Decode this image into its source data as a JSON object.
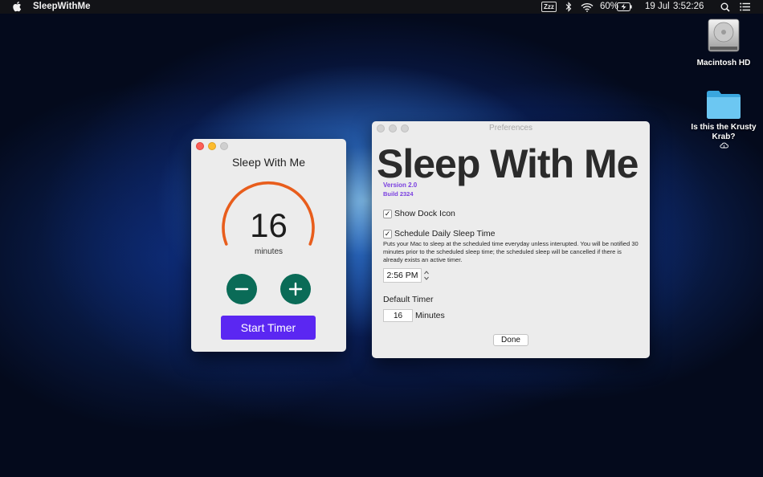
{
  "menubar": {
    "app_name": "SleepWithMe",
    "zzz_label": "Zzz",
    "battery_percent": "60%",
    "date": "19 Jul",
    "time": "3:52:26"
  },
  "desktop": {
    "items": [
      {
        "label": "Macintosh HD"
      },
      {
        "label": "Is this the Krusty Krab?"
      }
    ]
  },
  "timer_window": {
    "title": "Sleep With Me",
    "dial_value": "16",
    "dial_unit": "minutes",
    "dial_fill_fraction": 0.72,
    "start_button": "Start Timer",
    "accent_color": "#e85d1c",
    "button_color": "#0a6b57",
    "start_color": "#5b27f2"
  },
  "preferences": {
    "window_title": "Preferences",
    "app_title": "Sleep With Me",
    "version": "Version 2.0",
    "build": "Build 2324",
    "show_dock_icon": {
      "label": "Show Dock Icon",
      "checked": true
    },
    "schedule_sleep": {
      "label": "Schedule Daily Sleep Time",
      "checked": true
    },
    "schedule_description": "Puts your Mac to sleep at the scheduled time everyday unless interupted. You will be notified 30 minutes prior to the scheduled sleep time; the scheduled sleep will be cancelled if there is already exists an active timer.",
    "scheduled_time": "2:56 PM",
    "default_timer_label": "Default Timer",
    "default_timer_value": "16",
    "minutes_label": "Minutes",
    "done_button": "Done"
  }
}
